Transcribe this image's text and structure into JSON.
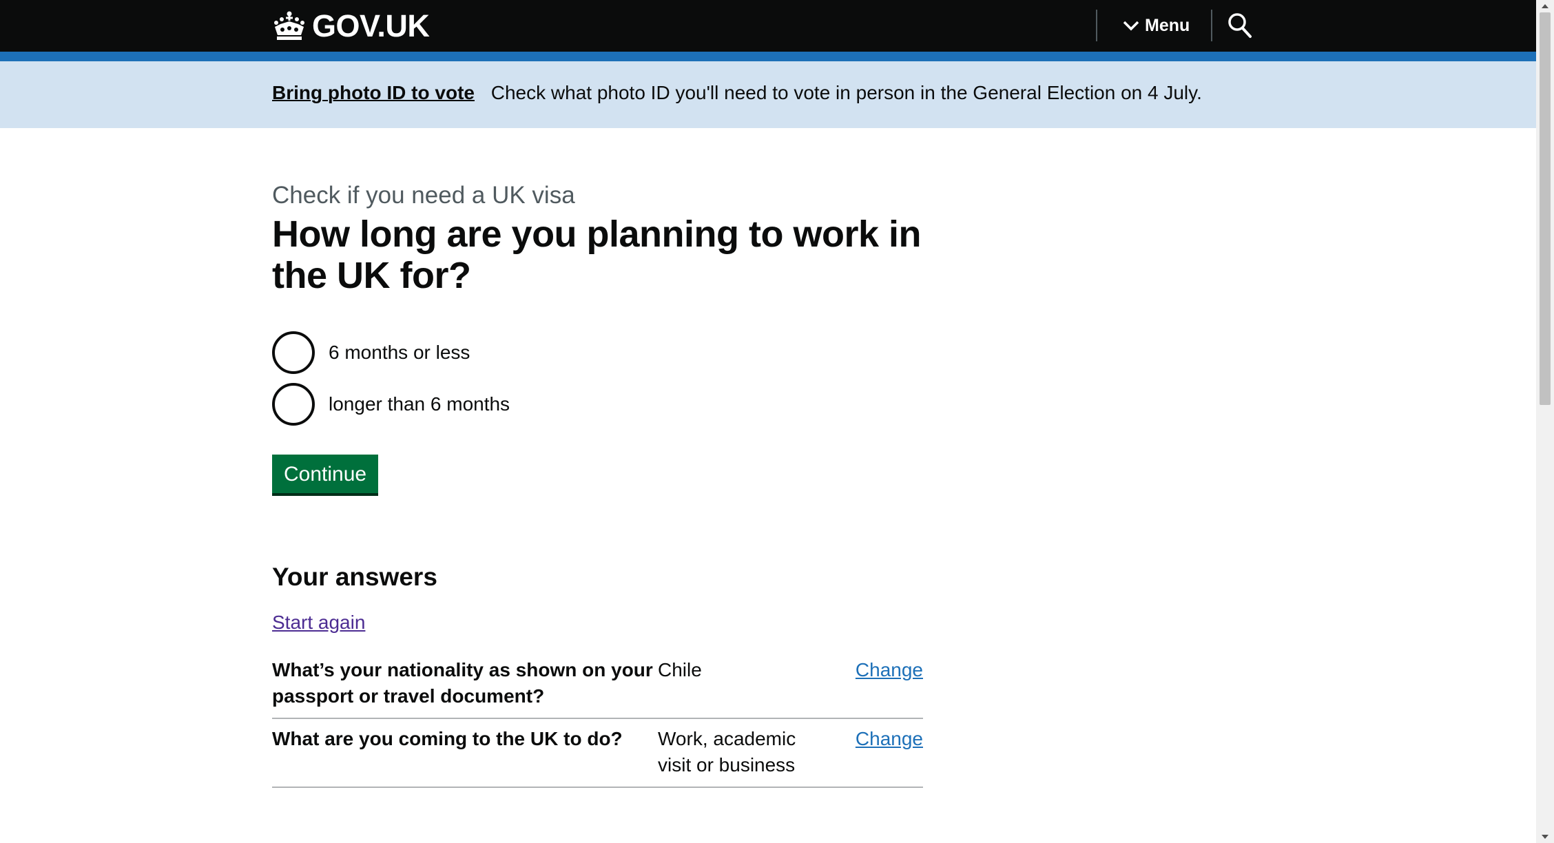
{
  "header": {
    "logo_text": "GOV.UK",
    "menu_label": "Menu",
    "icons": {
      "logo": "crown-icon",
      "menu": "chevron-down-icon",
      "search": "search-icon"
    }
  },
  "banner": {
    "link_text": "Bring photo ID to vote",
    "text": "Check what photo ID you'll need to vote in person in the General Election on 4 July."
  },
  "main": {
    "caption": "Check if you need a UK visa",
    "title": "How long are you planning to work in the UK for?",
    "options": [
      {
        "label": "6 months or less",
        "selected": false
      },
      {
        "label": "longer than 6 months",
        "selected": false
      }
    ],
    "continue_label": "Continue"
  },
  "answers": {
    "heading": "Your answers",
    "start_again": "Start again",
    "rows": [
      {
        "question": "What’s your nationality as shown on your passport or travel document?",
        "answer": "Chile",
        "change": "Change"
      },
      {
        "question": "What are you coming to the UK to do?",
        "answer": "Work, academic visit or business",
        "change": "Change"
      }
    ]
  },
  "colors": {
    "header_bg": "#0b0c0c",
    "header_accent": "#1d70b8",
    "banner_bg": "#d2e2f1",
    "button_green": "#00703c",
    "link_blue": "#1d70b8",
    "visited_link": "#4c2c92"
  }
}
